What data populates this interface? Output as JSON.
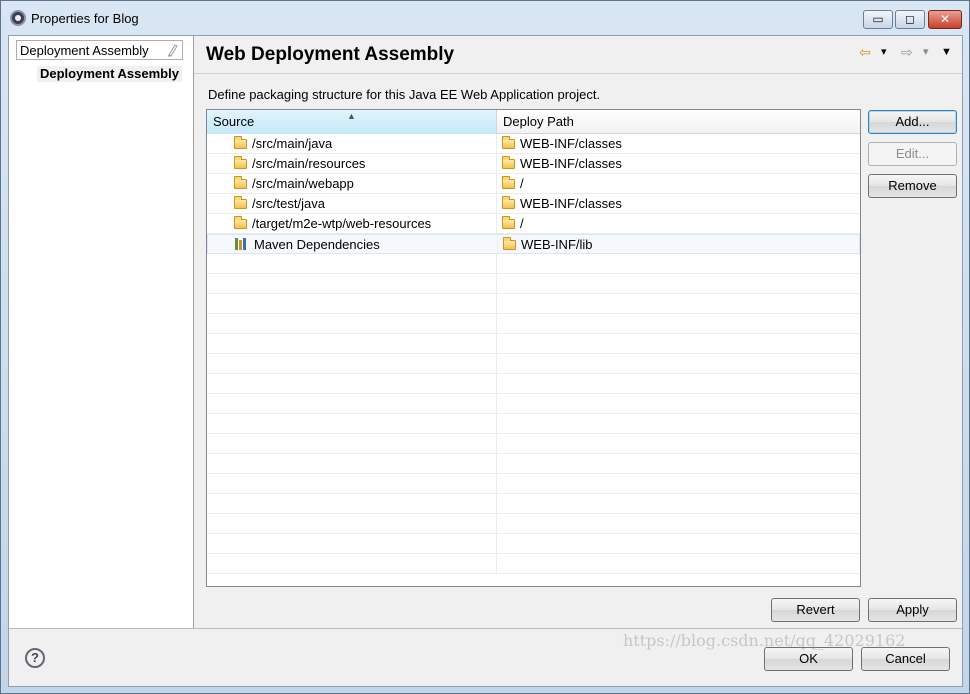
{
  "window": {
    "title": "Properties for Blog",
    "controls": {
      "minimize": "▭",
      "maximize": "◻",
      "close": "✕"
    }
  },
  "sidebar": {
    "filter_value": "Deployment Assembly",
    "items": [
      {
        "label": "Deployment Assembly",
        "selected": true
      }
    ]
  },
  "page": {
    "title": "Web Deployment Assembly",
    "description": "Define packaging structure for this Java EE Web Application project."
  },
  "table": {
    "columns": [
      "Source",
      "Deploy Path"
    ],
    "sort_indicator": "▲",
    "rows": [
      {
        "source": "/src/main/java",
        "source_icon": "folder-icon",
        "deploy": "WEB-INF/classes",
        "deploy_icon": "folder-icon"
      },
      {
        "source": "/src/main/resources",
        "source_icon": "folder-icon",
        "deploy": "WEB-INF/classes",
        "deploy_icon": "folder-icon"
      },
      {
        "source": "/src/main/webapp",
        "source_icon": "folder-icon",
        "deploy": "/",
        "deploy_icon": "folder-icon"
      },
      {
        "source": "/src/test/java",
        "source_icon": "folder-icon",
        "deploy": "WEB-INF/classes",
        "deploy_icon": "folder-icon"
      },
      {
        "source": "/target/m2e-wtp/web-resources",
        "source_icon": "folder-icon",
        "deploy": "/",
        "deploy_icon": "folder-icon"
      },
      {
        "source": "Maven Dependencies",
        "source_icon": "library-icon",
        "deploy": "WEB-INF/lib",
        "deploy_icon": "folder-icon"
      }
    ],
    "empty_rows": 16
  },
  "buttons": {
    "add": "Add...",
    "edit": "Edit...",
    "remove": "Remove",
    "revert": "Revert",
    "apply": "Apply",
    "ok": "OK",
    "cancel": "Cancel"
  },
  "nav": {
    "back": "⇦",
    "forward": "⇨",
    "dropdown": "▾",
    "menu": "▼"
  },
  "help": "?",
  "watermark": "https://blog.csdn.net/qq_42029162",
  "colors": {
    "accent": "#3c7fb1",
    "sort_header": "#c4e9f9",
    "folder": "#f2c14e"
  }
}
